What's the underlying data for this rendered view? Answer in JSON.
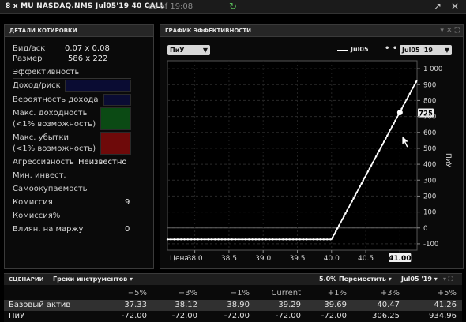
{
  "title": {
    "main": "8 x MU NASDAQ.NMS Jul05'19 40 CALL",
    "asof": "as of 19:08"
  },
  "quote": {
    "header": "ДЕТАЛИ КОТИРОВКИ",
    "bid_ask_label": "Бид/аск",
    "bid_ask_value": "0.07 x 0.08",
    "size_label": "Размер",
    "size_value": "586 x 222",
    "efficiency_label": "Эффективность",
    "income_risk_label": "Доход/риск",
    "prob_label": "Вероятность дохода",
    "max_profit_label_1": "Макс. доходность",
    "max_profit_label_2": "(<1% возможность)",
    "max_loss_label_1": "Макс. убытки",
    "max_loss_label_2": "(<1% возможность)",
    "aggr_label": "Агрессивность",
    "aggr_value": "Неизвестно",
    "min_inv_label": "Мин. инвест.",
    "payback_label": "Самоокупаемость",
    "commission_label": "Комиссия",
    "commission_value": "9",
    "commission_pct_label": "Комиссия%",
    "margin_label": "Влиян. на маржу",
    "margin_value": "0",
    "colors": {
      "navy": "#0a0c33",
      "green": "#0b4a14",
      "red": "#6e0a0a"
    }
  },
  "chart_panel": {
    "header": "ГРАФИК ЭФФЕКТИВНОСТИ",
    "left_dropdown": "ПиУ",
    "legend_solid": "Jul05",
    "legend_dotted_dropdown": "Jul05 '19",
    "y_axis_label": "ПиУ",
    "x_axis_prefix": "Цена:",
    "marker_label": "725",
    "x_highlight": "41.00"
  },
  "chart_data": {
    "type": "line",
    "x_ticks": [
      "38.0",
      "38.5",
      "39.0",
      "39.5",
      "40.0",
      "40.5",
      "41.00"
    ],
    "y_ticks": [
      "1 000",
      "900",
      "800",
      "700",
      "600",
      "500",
      "400",
      "300",
      "200",
      "100",
      "0",
      "-100"
    ],
    "xlim": [
      37.6,
      41.25
    ],
    "ylim": [
      -140,
      1050
    ],
    "series": [
      {
        "name": "Jul05",
        "style": "solid",
        "x": [
          37.6,
          40.0,
          41.25
        ],
        "y": [
          -72,
          -72,
          928
        ]
      },
      {
        "name": "Jul05 '19",
        "style": "dotted",
        "x": [
          37.6,
          40.0,
          41.25
        ],
        "y": [
          -72,
          -72,
          928
        ]
      }
    ],
    "marker": {
      "x": 41.0,
      "y": 725
    }
  },
  "scenarios": {
    "label": "СЦЕНАРИИ",
    "greeks_dropdown": "Греки инструментов",
    "shift_dropdown": "5.0% Переместить",
    "expiry_dropdown": "Jul05 '19",
    "columns": [
      "−5%",
      "−3%",
      "−1%",
      "Current",
      "+1%",
      "+3%",
      "+5%"
    ],
    "rows": [
      {
        "label": "Базовый актив",
        "values": [
          "37.33",
          "38.12",
          "38.90",
          "39.29",
          "39.69",
          "40.47",
          "41.26"
        ]
      },
      {
        "label": "ПиУ",
        "values": [
          "-72.00",
          "-72.00",
          "-72.00",
          "-72.00",
          "-72.00",
          "306.25",
          "934.96"
        ]
      }
    ]
  }
}
